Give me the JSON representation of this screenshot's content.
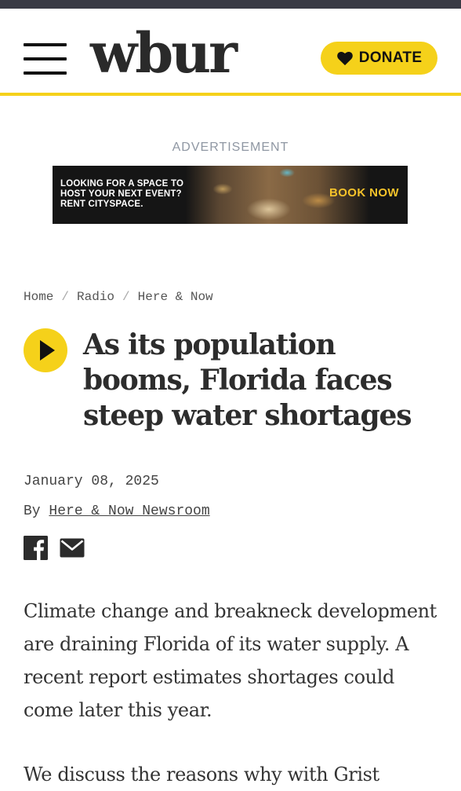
{
  "header": {
    "logo_text": "wbur",
    "menu_icon": "hamburger-menu-icon",
    "donate_label": "DONATE",
    "donate_icon": "heart-icon",
    "brand_color": "#f5d11a"
  },
  "advertisement": {
    "label": "ADVERTISEMENT",
    "text": "LOOKING FOR A SPACE TO HOST YOUR NEXT EVENT? RENT CITYSPACE.",
    "cta": "BOOK NOW"
  },
  "breadcrumb": {
    "items": [
      "Home",
      "Radio",
      "Here & Now"
    ],
    "separator": "/"
  },
  "article": {
    "play_icon": "play-icon",
    "title": "As its population booms, Florida faces steep water shortages",
    "date": "January 08, 2025",
    "byline_prefix": "By",
    "author": "Here & Now Newsroom",
    "share_icons": [
      "facebook-icon",
      "email-icon"
    ],
    "paragraphs": [
      "Climate change and breakneck development are draining Florida of its water supply. A recent report estimates shortages could come later this year.",
      "We discuss the reasons why with Grist"
    ]
  }
}
